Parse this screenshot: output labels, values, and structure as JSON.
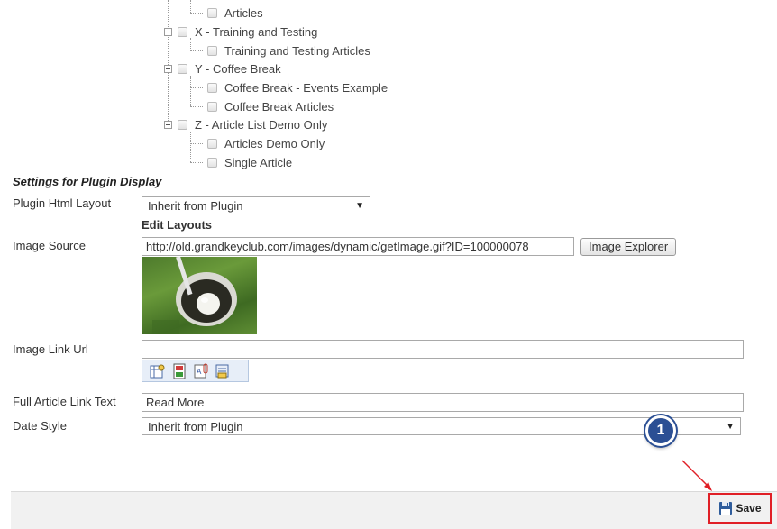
{
  "tree": {
    "items": [
      {
        "label": "Articles"
      },
      {
        "label": "X - Training and Testing"
      },
      {
        "label": "Training and Testing Articles"
      },
      {
        "label": "Y - Coffee Break"
      },
      {
        "label": "Coffee Break - Events Example"
      },
      {
        "label": "Coffee Break Articles"
      },
      {
        "label": "Z - Article List Demo Only"
      },
      {
        "label": "Articles Demo Only"
      },
      {
        "label": "Single Article"
      }
    ]
  },
  "settings": {
    "title": "Settings for Plugin Display",
    "plugin_html_layout": {
      "label": "Plugin Html Layout",
      "value": "Inherit from Plugin",
      "edit_layouts": "Edit Layouts"
    },
    "image_source": {
      "label": "Image Source",
      "value": "http://old.grandkeyclub.com/images/dynamic/getImage.gif?ID=100000078",
      "button": "Image Explorer"
    },
    "image_link_url": {
      "label": "Image Link Url",
      "value": ""
    },
    "full_article_link_text": {
      "label": "Full Article Link Text",
      "value": "Read More"
    },
    "date_style": {
      "label": "Date Style",
      "value": "Inherit from Plugin"
    }
  },
  "link_toolbar": {
    "icons": [
      "page-link-icon",
      "document-link-icon",
      "file-attach-icon",
      "email-link-icon"
    ]
  },
  "footer": {
    "save_label": "Save"
  },
  "callout": {
    "number": "1",
    "color": "#2b4f94"
  },
  "highlight_color": "#e01f26"
}
